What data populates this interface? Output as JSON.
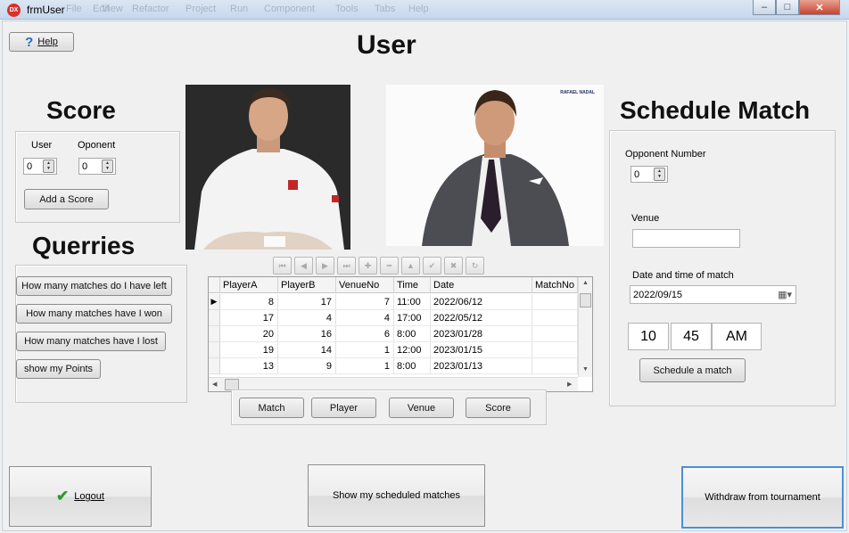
{
  "window": {
    "title": "frmUser",
    "icon": "DX",
    "background_menu": [
      "File",
      "Edit",
      "View",
      "Refactor",
      "Project",
      "Run",
      "Component",
      "Tools",
      "Tabs",
      "Help"
    ],
    "controls": {
      "minimize": "–",
      "maximize": "□",
      "close": "✕"
    }
  },
  "help_button": {
    "label": "Help",
    "icon": "?"
  },
  "page_title": "User",
  "score": {
    "heading": "Score",
    "user_label": "User",
    "user_value": "0",
    "opponent_label": "Oponent",
    "opponent_value": "0",
    "add_button": "Add a Score"
  },
  "queries": {
    "heading": "Querries",
    "buttons": [
      "How many matches do I have left",
      "How many matches have I won",
      "How many matches have I lost",
      "show my Points"
    ]
  },
  "photos": {
    "left": "player-photo-federer",
    "right": "player-photo-nadal",
    "right_logo": "RAFAEL NADAL"
  },
  "navigator": {
    "icons": [
      "first-record-icon",
      "prior-record-icon",
      "next-record-icon",
      "last-record-icon",
      "insert-record-icon",
      "delete-record-icon",
      "edit-record-icon",
      "post-edit-icon",
      "cancel-edit-icon",
      "refresh-data-icon"
    ],
    "glyphs": [
      "⏮",
      "◀",
      "▶",
      "⏭",
      "✚",
      "━",
      "▲",
      "✔",
      "✖",
      "↻"
    ]
  },
  "grid": {
    "columns": [
      "PlayerA",
      "PlayerB",
      "VenueNo",
      "Time",
      "Date",
      "MatchNo"
    ],
    "rows": [
      [
        "8",
        "17",
        "7",
        "11:00",
        "2022/06/12",
        ""
      ],
      [
        "17",
        "4",
        "4",
        "17:00",
        "2022/05/12",
        ""
      ],
      [
        "20",
        "16",
        "6",
        "8:00",
        "2023/01/28",
        ""
      ],
      [
        "19",
        "14",
        "1",
        "12:00",
        "2023/01/15",
        ""
      ],
      [
        "13",
        "9",
        "1",
        "8:00",
        "2023/01/13",
        ""
      ]
    ],
    "current_row_marker": "▶"
  },
  "table_buttons": [
    "Match",
    "Player",
    "Venue",
    "Score"
  ],
  "schedule": {
    "heading": "Schedule Match",
    "opponent_label": "Opponent Number",
    "opponent_value": "0",
    "venue_label": "Venue",
    "venue_value": "",
    "date_label": "Date and time of match",
    "date_value": "2022/09/15",
    "hour": "10",
    "minute": "45",
    "ampm": "AM",
    "button": "Schedule a match"
  },
  "bottom": {
    "logout": "Logout",
    "show_scheduled": "Show my scheduled matches",
    "withdraw": "Withdraw from tournament"
  },
  "colors": {
    "titlebar": "#c7d7ec",
    "close": "#c7442d",
    "form": "#f0f0f0",
    "check": "#2e9a2e",
    "help": "#1a6fc9"
  }
}
